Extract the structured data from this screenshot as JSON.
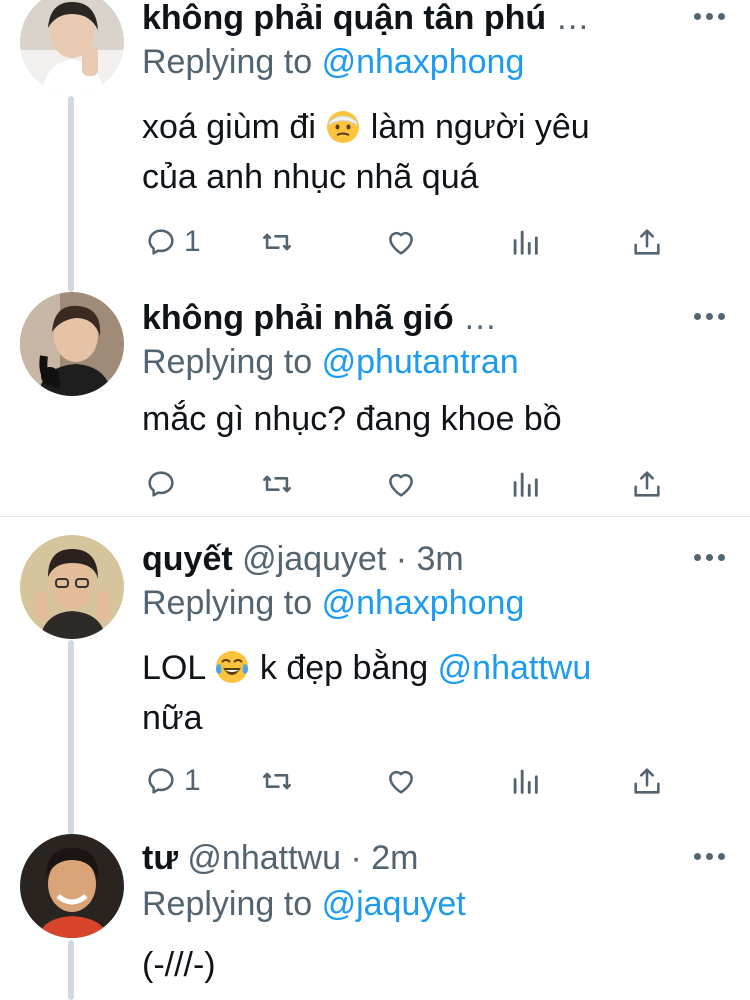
{
  "tweets": [
    {
      "name": "không phải quận tân phú",
      "handle": "…",
      "reply_prefix": "Replying to",
      "reply_to": "@nhaxphong",
      "text_line1_a": "xoá giùm đi",
      "text_line1_b": "làm người yêu",
      "text_line2": "của anh nhục nhã quá",
      "emoji1": "dizzy-face-emoji",
      "reply_count": "1",
      "avatar": "avatar-person-white-shirt"
    },
    {
      "name": "không phải nhã gió",
      "handle": "…",
      "reply_prefix": "Replying to",
      "reply_to": "@phutantran",
      "text": "mắc gì nhục? đang khoe bồ",
      "reply_count": "",
      "avatar": "avatar-person-headphones"
    },
    {
      "name": "quyết",
      "handle": "@jaquyet · 3m",
      "reply_prefix": "Replying to",
      "reply_to": "@nhaxphong",
      "text_a": "LOL",
      "emoji": "tears-of-joy-emoji",
      "text_b": "k đẹp bằng",
      "mention": "@nhattwu",
      "text_line2": "nữa",
      "reply_count": "1",
      "avatar": "avatar-person-glasses"
    },
    {
      "name": "tư",
      "handle": "@nhattwu · 2m",
      "reply_prefix": "Replying to",
      "reply_to": "@jaquyet",
      "text": "(-///-)",
      "avatar": "avatar-person-smiling"
    }
  ],
  "icons": {
    "reply": "reply-icon",
    "retweet": "retweet-icon",
    "like": "like-icon",
    "views": "views-icon",
    "share": "share-icon",
    "more": "more-icon"
  },
  "colors": {
    "link": "#1d9bf0",
    "secondary": "#536471",
    "thread_line": "#cfd9de"
  }
}
